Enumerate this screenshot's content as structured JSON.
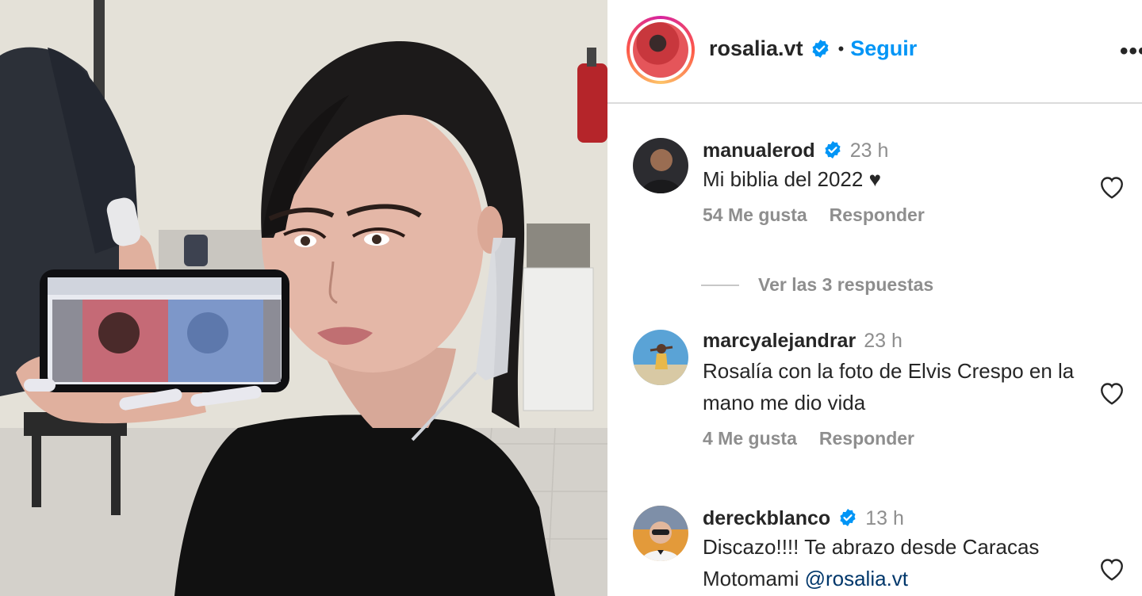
{
  "post": {
    "owner": "rosalia.vt",
    "separator": "•",
    "follow_label": "Seguir",
    "more_label": "•••"
  },
  "comments": [
    {
      "user": "manualerod",
      "verified": true,
      "time": "23 h",
      "text": "Mi biblia del 2022 ♥",
      "likes": "54 Me gusta",
      "reply_label": "Responder",
      "view_replies": "Ver las 3 respuestas"
    },
    {
      "user": "marcyalejandrar",
      "verified": false,
      "time": "23 h",
      "text": "Rosalía con la foto de Elvis Crespo en la mano me dio vida",
      "likes": "4 Me gusta",
      "reply_label": "Responder"
    },
    {
      "user": "dereckblanco",
      "verified": true,
      "time": "13 h",
      "text_main": "Discazo!!!! Te abrazo desde Caracas Motomami ",
      "mention": "@rosalia.vt"
    }
  ],
  "colors": {
    "accent": "#0095f6",
    "muted": "#8e8e8e",
    "text": "#262626",
    "divider": "#dbdbdb"
  },
  "icons": {
    "verified": "verified-badge-icon",
    "like": "heart-outline-icon",
    "more": "more-options-icon"
  }
}
